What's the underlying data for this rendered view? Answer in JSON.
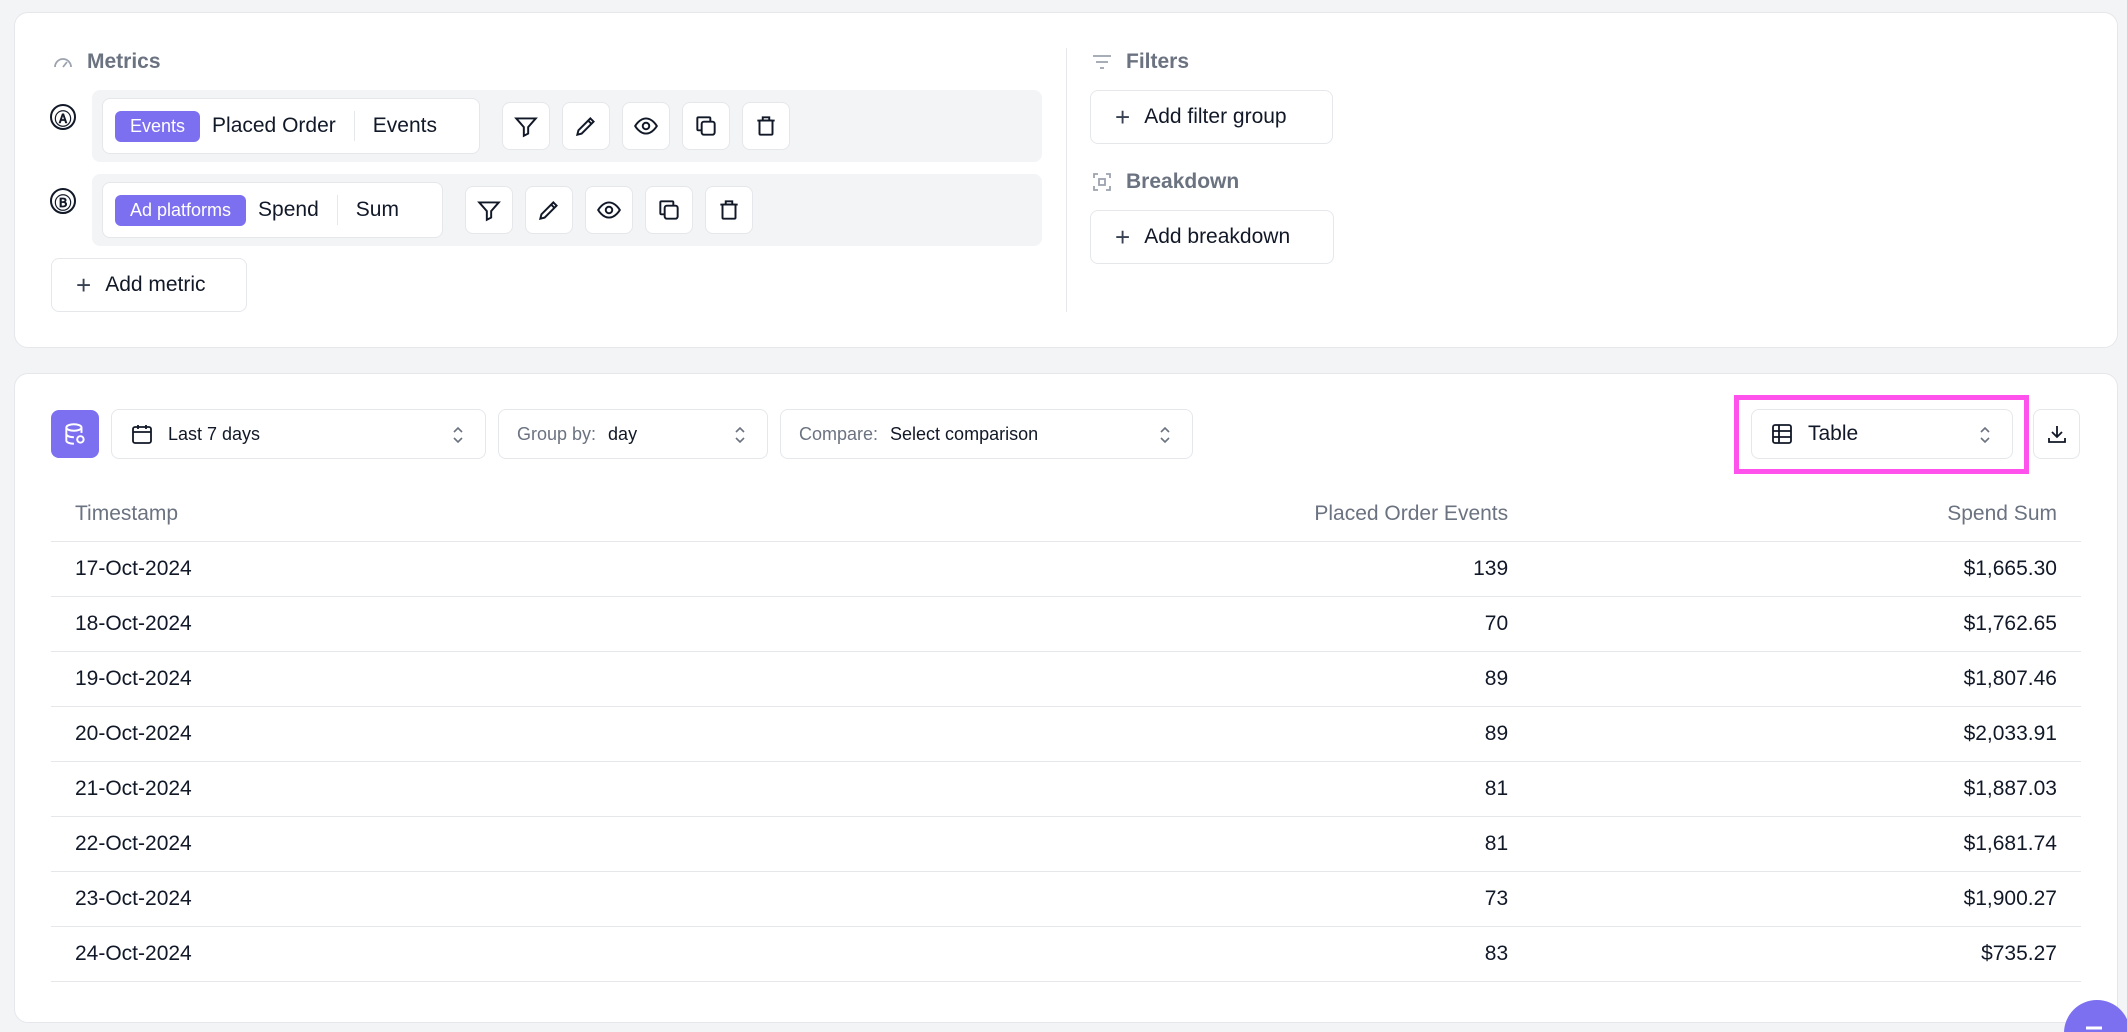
{
  "metrics": {
    "label": "Metrics",
    "rows": [
      {
        "letter": "Ⓐ",
        "source": "Events",
        "name": "Placed Order",
        "aggregation": "Events"
      },
      {
        "letter": "Ⓑ",
        "source": "Ad platforms",
        "name": "Spend",
        "aggregation": "Sum"
      }
    ],
    "add_label": "Add metric"
  },
  "filters": {
    "label": "Filters",
    "add_label": "Add filter group"
  },
  "breakdown": {
    "label": "Breakdown",
    "add_label": "Add breakdown"
  },
  "controls": {
    "date_range": "Last 7 days",
    "group_by_label": "Group by:",
    "group_by_value": "day",
    "compare_label": "Compare:",
    "compare_value": "Select comparison",
    "view_type": "Table"
  },
  "table": {
    "columns": [
      "Timestamp",
      "Placed Order Events",
      "Spend Sum"
    ],
    "rows": [
      [
        "17-Oct-2024",
        "139",
        "$1,665.30"
      ],
      [
        "18-Oct-2024",
        "70",
        "$1,762.65"
      ],
      [
        "19-Oct-2024",
        "89",
        "$1,807.46"
      ],
      [
        "20-Oct-2024",
        "89",
        "$2,033.91"
      ],
      [
        "21-Oct-2024",
        "81",
        "$1,887.03"
      ],
      [
        "22-Oct-2024",
        "81",
        "$1,681.74"
      ],
      [
        "23-Oct-2024",
        "73",
        "$1,900.27"
      ],
      [
        "24-Oct-2024",
        "83",
        "$735.27"
      ]
    ]
  },
  "colors": {
    "accent": "#7c6ff0",
    "highlight": "#ff52ec",
    "border": "#e5e7eb",
    "muted": "#6b7280"
  },
  "icons": [
    "gauge-icon",
    "filter-icon",
    "pencil-icon",
    "eye-icon",
    "copy-icon",
    "trash-icon",
    "plus-icon",
    "breakdown-icon",
    "calendar-icon",
    "chevron-updown-icon",
    "database-icon",
    "table-icon",
    "download-icon",
    "chat-icon"
  ]
}
